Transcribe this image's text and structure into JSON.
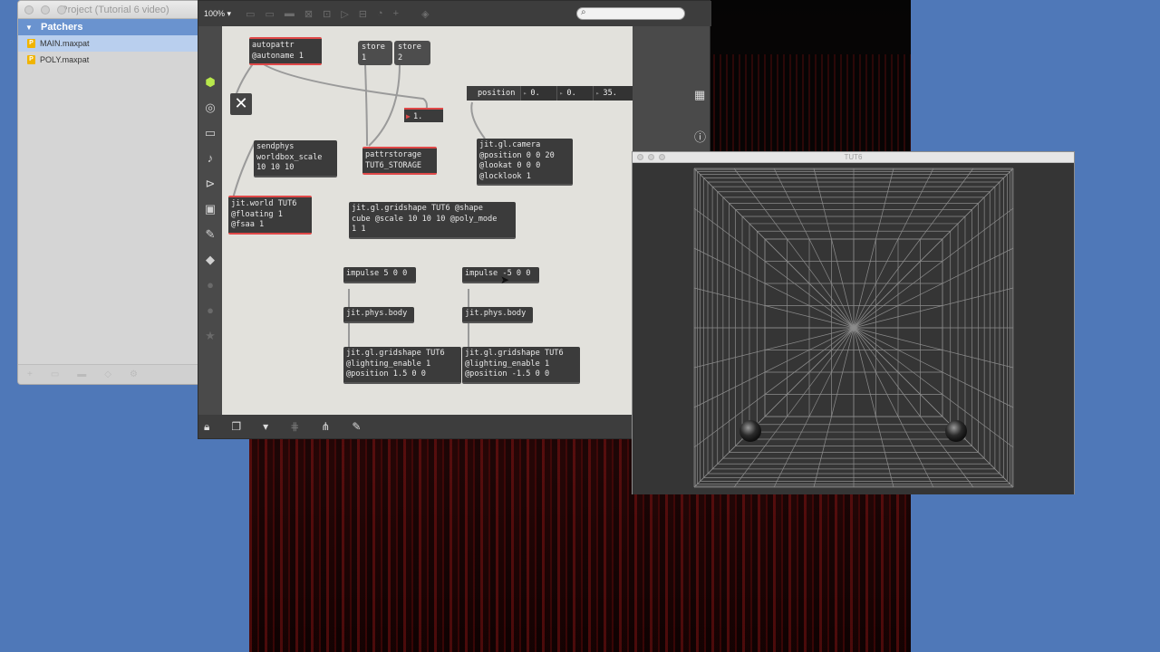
{
  "project": {
    "title": "Project (Tutorial 6 video)",
    "group": "Patchers",
    "files": [
      {
        "icon": "P",
        "name": "MAIN.maxpat",
        "selected": true
      },
      {
        "icon": "P",
        "name": "POLY.maxpat",
        "selected": false
      }
    ]
  },
  "patcher": {
    "zoom": "100%",
    "zoom_arrow": "▾",
    "search_placeholder": "",
    "objects": {
      "autopattr": "autopattr\n@autoname 1",
      "store1": "store\n1",
      "store2": "store\n2",
      "close_button": "✕",
      "number_box": "1.",
      "sendphys": "sendphys\nworldbox_scale\n10 10 10",
      "pattrstorage": "pattrstorage\nTUT6_STORAGE",
      "jit_world": "jit.world TUT6\n@floating 1\n@fsaa 1",
      "position_label": "position",
      "position_values": [
        "0.",
        "0.",
        "35."
      ],
      "camera": "jit.gl.camera\n@position 0 0 20\n@lookat 0 0 0\n@locklook 1",
      "gridshape_cube": "jit.gl.gridshape TUT6 @shape\ncube @scale 10 10 10 @poly_mode\n1 1",
      "impulse_left": "impulse 5 0 0",
      "impulse_right": "impulse -5 0 0",
      "phys_left": "jit.phys.body",
      "phys_right": "jit.phys.body",
      "gridshape_left": "jit.gl.gridshape TUT6\n@lighting_enable 1\n@position 1.5 0 0",
      "gridshape_right": "jit.gl.gridshape TUT6\n@lighting_enable 1\n@position -1.5 0 0"
    }
  },
  "render_window": {
    "title": "TUT6"
  },
  "icons": {
    "left_toolbar": [
      "cube-icon",
      "target-icon",
      "keyboard-icon",
      "note-icon",
      "play-step-icon",
      "image-icon",
      "paperclip-icon",
      "puzzle-icon",
      "circle-icon",
      "circle-icon",
      "star-icon"
    ],
    "bottom_toolbar": [
      "lock-icon",
      "presentation-icon",
      "comment-icon",
      "grid-icon",
      "network-icon",
      "wrench-icon"
    ]
  }
}
